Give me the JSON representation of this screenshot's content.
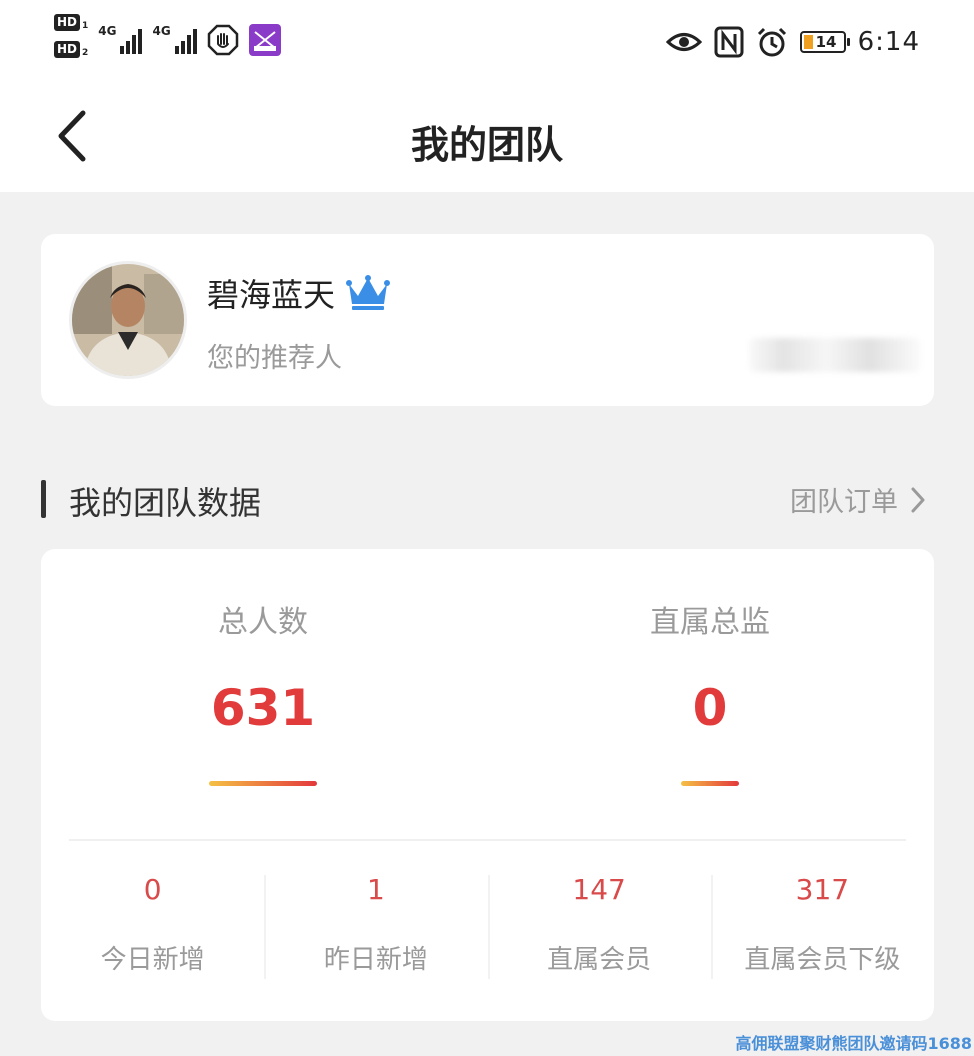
{
  "status_bar": {
    "sim1": {
      "badge": "HD",
      "slot": "1",
      "network": "4G"
    },
    "sim2": {
      "badge": "HD",
      "slot": "2",
      "network": "4G"
    },
    "left_icons": [
      "hand-icon",
      "app-badge-icon"
    ],
    "right_icons": [
      "eye-icon",
      "nfc-icon",
      "alarm-icon"
    ],
    "battery": "14",
    "time": "6:14",
    "battery_color": "#f0a020"
  },
  "nav": {
    "title": "我的团队",
    "back_icon": "chevron-left-icon"
  },
  "profile": {
    "name": "碧海蓝天",
    "crown_icon": "crown-icon",
    "crown_color": "#3a8ee6",
    "referrer_label": "您的推荐人",
    "referrer_value": "",
    "avatar": "avatar"
  },
  "section": {
    "title": "我的团队数据",
    "link": "团队订单",
    "link_icon": "chevron-right-icon"
  },
  "stats": {
    "primary": [
      {
        "label": "总人数",
        "value": "631"
      },
      {
        "label": "直属总监",
        "value": "0"
      }
    ],
    "secondary": [
      {
        "label": "今日新增",
        "value": "0"
      },
      {
        "label": "昨日新增",
        "value": "1"
      },
      {
        "label": "直属会员",
        "value": "147"
      },
      {
        "label": "直属会员下级",
        "value": "317"
      }
    ],
    "accent_color": "#e23b3b"
  },
  "watermark": "高佣联盟聚财熊团队邀请码1688"
}
